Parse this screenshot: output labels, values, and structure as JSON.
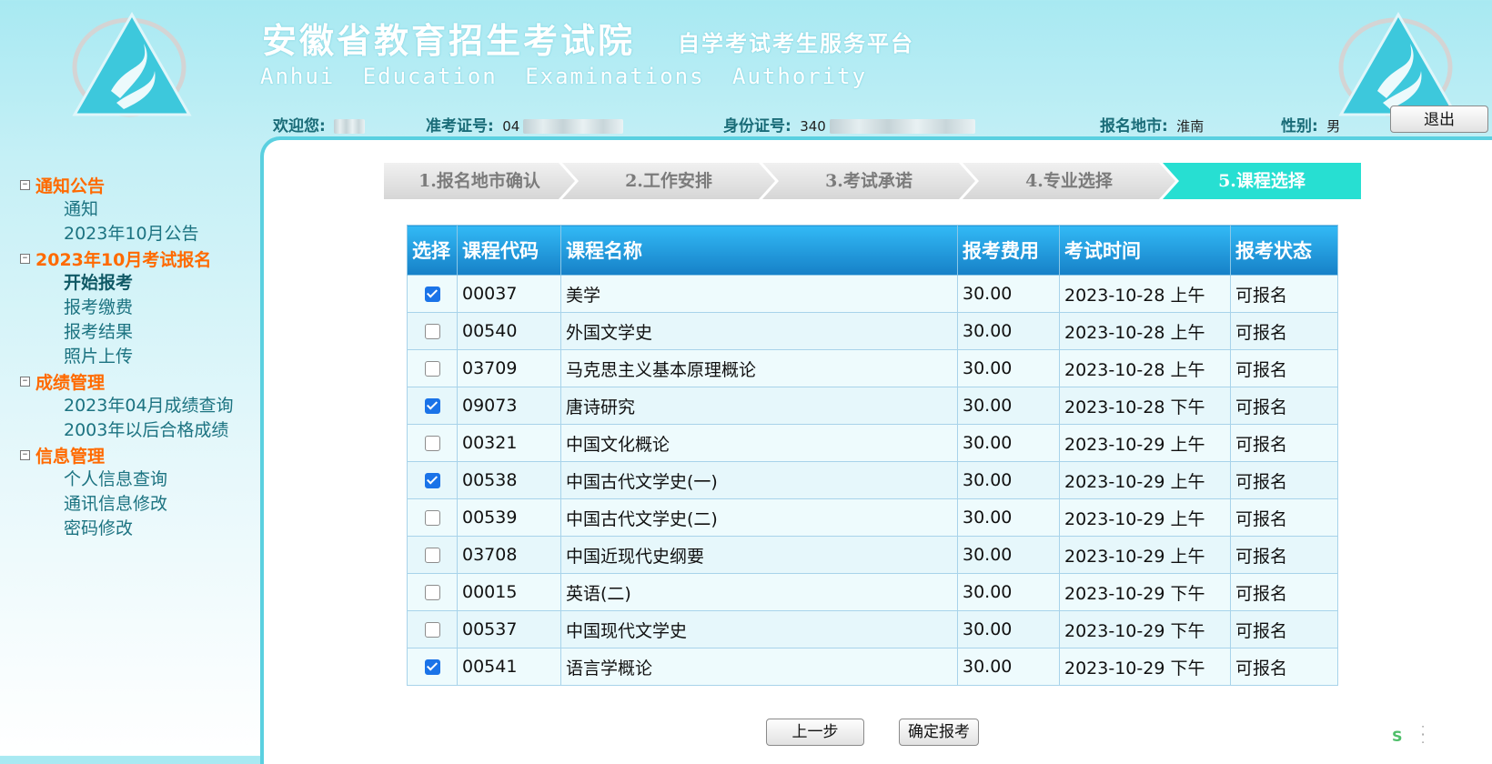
{
  "header": {
    "title_cn": "安徽省教育招生考试院",
    "subtitle_cn": "自学考试考生服务平台",
    "title_en": "Anhui Education Examinations Authority"
  },
  "user_info": {
    "welcome_label": "欢迎您:",
    "ticket_label": "准考证号:",
    "ticket_value": "04",
    "id_label": "身份证号:",
    "id_value": "340",
    "city_label": "报名地市:",
    "city_value": "淮南",
    "gender_label": "性别:",
    "gender_value": "男"
  },
  "logout_label": "退出",
  "sidebar": {
    "sections": [
      {
        "title": "通知公告",
        "toggle": "⊟",
        "items": [
          {
            "label": "通知"
          },
          {
            "label": "2023年10月公告"
          }
        ]
      },
      {
        "title": "2023年10月考试报名",
        "toggle": "⊟",
        "items": [
          {
            "label": "开始报考"
          },
          {
            "label": "报考缴费"
          },
          {
            "label": "报考结果"
          },
          {
            "label": "照片上传"
          }
        ]
      },
      {
        "title": "成绩管理",
        "toggle": "⊟",
        "items": [
          {
            "label": "2023年04月成绩查询"
          },
          {
            "label": "2003年以后合格成绩"
          }
        ]
      },
      {
        "title": "信息管理",
        "toggle": "⊟",
        "items": [
          {
            "label": "个人信息查询"
          },
          {
            "label": "通讯信息修改"
          },
          {
            "label": "密码修改"
          }
        ]
      }
    ]
  },
  "steps": [
    {
      "label": "1.报名地市确认"
    },
    {
      "label": "2.工作安排"
    },
    {
      "label": "3.考试承诺"
    },
    {
      "label": "4.专业选择"
    },
    {
      "label": "5.课程选择"
    }
  ],
  "table": {
    "headers": [
      "选择",
      "课程代码",
      "课程名称",
      "报考费用",
      "考试时间",
      "报考状态"
    ],
    "rows": [
      {
        "checked": true,
        "code": "00037",
        "name": "美学",
        "fee": "30.00",
        "time": "2023-10-28 上午",
        "status": "可报名"
      },
      {
        "checked": false,
        "code": "00540",
        "name": "外国文学史",
        "fee": "30.00",
        "time": "2023-10-28 上午",
        "status": "可报名"
      },
      {
        "checked": false,
        "code": "03709",
        "name": "马克思主义基本原理概论",
        "fee": "30.00",
        "time": "2023-10-28 上午",
        "status": "可报名"
      },
      {
        "checked": true,
        "code": "09073",
        "name": "唐诗研究",
        "fee": "30.00",
        "time": "2023-10-28 下午",
        "status": "可报名"
      },
      {
        "checked": false,
        "code": "00321",
        "name": "中国文化概论",
        "fee": "30.00",
        "time": "2023-10-29 上午",
        "status": "可报名"
      },
      {
        "checked": true,
        "code": "00538",
        "name": "中国古代文学史(一)",
        "fee": "30.00",
        "time": "2023-10-29 上午",
        "status": "可报名"
      },
      {
        "checked": false,
        "code": "00539",
        "name": "中国古代文学史(二)",
        "fee": "30.00",
        "time": "2023-10-29 上午",
        "status": "可报名"
      },
      {
        "checked": false,
        "code": "03708",
        "name": "中国近现代史纲要",
        "fee": "30.00",
        "time": "2023-10-29 上午",
        "status": "可报名"
      },
      {
        "checked": false,
        "code": "00015",
        "name": "英语(二)",
        "fee": "30.00",
        "time": "2023-10-29 下午",
        "status": "可报名"
      },
      {
        "checked": false,
        "code": "00537",
        "name": "中国现代文学史",
        "fee": "30.00",
        "time": "2023-10-29 下午",
        "status": "可报名"
      },
      {
        "checked": true,
        "code": "00541",
        "name": "语言学概论",
        "fee": "30.00",
        "time": "2023-10-29 下午",
        "status": "可报名"
      }
    ]
  },
  "buttons": {
    "prev": "上一步",
    "confirm": "确定报考"
  },
  "colors": {
    "accent_orange": "#ff6a00",
    "teal_text": "#1c7381",
    "active_step": "#27dfd2",
    "table_header": "#1680c7",
    "checkbox_checked": "#1a73e8"
  }
}
